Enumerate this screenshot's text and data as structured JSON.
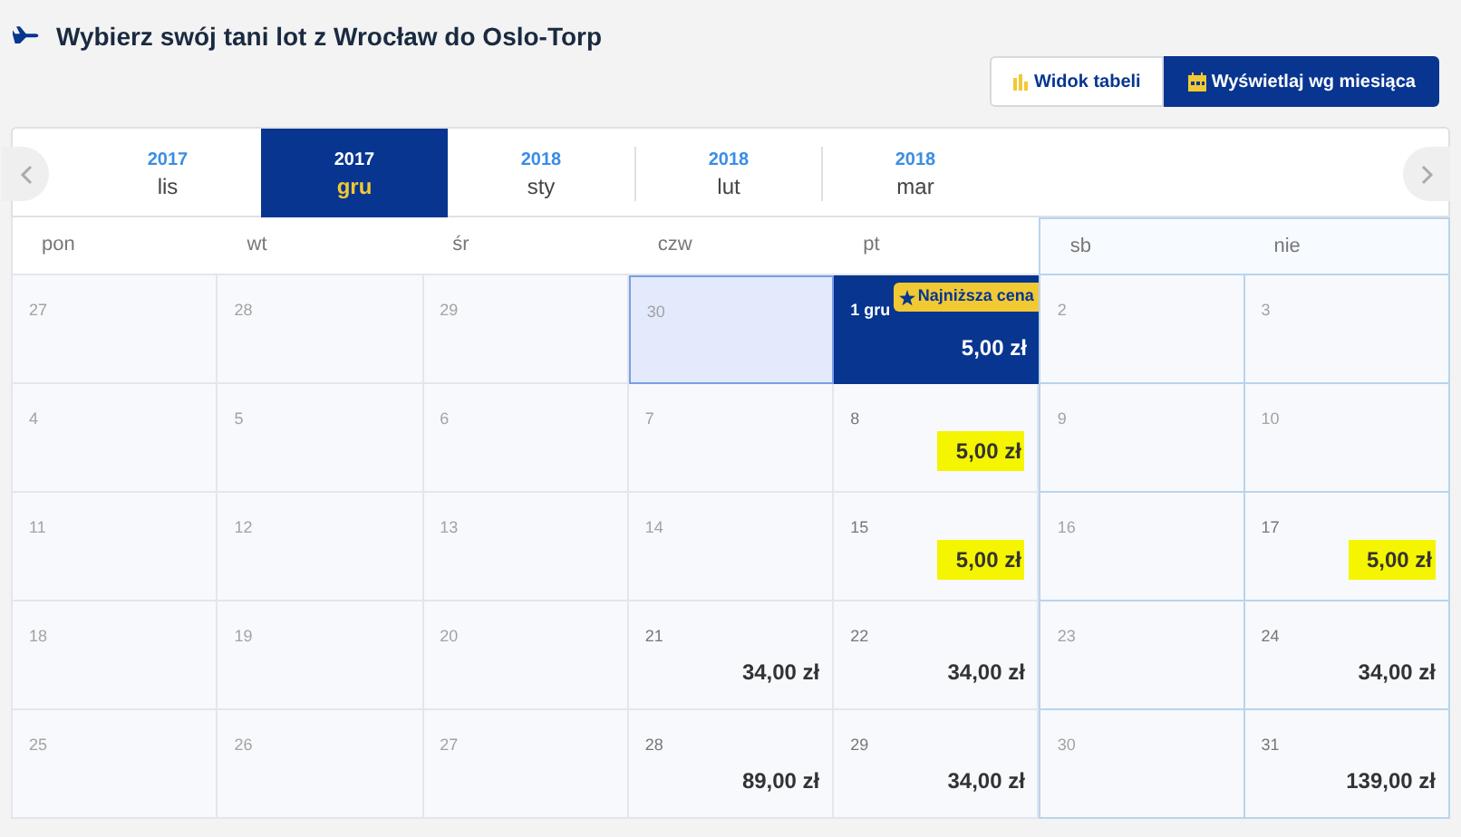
{
  "title": "Wybierz swój tani lot z Wrocław do Oslo-Torp",
  "view_buttons": [
    {
      "label": "Widok tabeli",
      "kind": "table",
      "selected": false
    },
    {
      "label": "Wyświetlaj wg miesiąca",
      "kind": "month",
      "selected": true
    }
  ],
  "months": [
    {
      "year": "2017",
      "month": "lis",
      "selected": false
    },
    {
      "year": "2017",
      "month": "gru",
      "selected": true
    },
    {
      "year": "2018",
      "month": "sty",
      "selected": false
    },
    {
      "year": "2018",
      "month": "lut",
      "selected": false
    },
    {
      "year": "2018",
      "month": "mar",
      "selected": false
    }
  ],
  "weekdays": [
    {
      "label": "pon",
      "weekend": false
    },
    {
      "label": "wt",
      "weekend": false
    },
    {
      "label": "śr",
      "weekend": false
    },
    {
      "label": "czw",
      "weekend": false
    },
    {
      "label": "pt",
      "weekend": false
    },
    {
      "label": "sb",
      "weekend": true
    },
    {
      "label": "nie",
      "weekend": true
    }
  ],
  "weeks": [
    [
      {
        "day": "27",
        "muted": true
      },
      {
        "day": "28",
        "muted": true
      },
      {
        "day": "29",
        "muted": true
      },
      {
        "day": "30",
        "muted": true,
        "hovered": true
      },
      {
        "day": "1 gru",
        "muted": false,
        "selected": true,
        "badge": "Najniższa cena",
        "price": "5,00 zł"
      },
      {
        "day": "2",
        "muted": true
      },
      {
        "day": "3",
        "muted": true
      }
    ],
    [
      {
        "day": "4",
        "muted": true
      },
      {
        "day": "5",
        "muted": true
      },
      {
        "day": "6",
        "muted": true
      },
      {
        "day": "7",
        "muted": true
      },
      {
        "day": "8",
        "muted": false,
        "price": "5,00 zł",
        "highlighted": true
      },
      {
        "day": "9",
        "muted": true
      },
      {
        "day": "10",
        "muted": true
      }
    ],
    [
      {
        "day": "11",
        "muted": true
      },
      {
        "day": "12",
        "muted": true
      },
      {
        "day": "13",
        "muted": true
      },
      {
        "day": "14",
        "muted": true
      },
      {
        "day": "15",
        "muted": false,
        "price": "5,00 zł",
        "highlighted": true
      },
      {
        "day": "16",
        "muted": true
      },
      {
        "day": "17",
        "muted": false,
        "price": "5,00 zł",
        "highlighted": true
      }
    ],
    [
      {
        "day": "18",
        "muted": true
      },
      {
        "day": "19",
        "muted": true
      },
      {
        "day": "20",
        "muted": true
      },
      {
        "day": "21",
        "muted": false,
        "price": "34,00 zł"
      },
      {
        "day": "22",
        "muted": false,
        "price": "34,00 zł"
      },
      {
        "day": "23",
        "muted": true
      },
      {
        "day": "24",
        "muted": false,
        "price": "34,00 zł"
      }
    ],
    [
      {
        "day": "25",
        "muted": true
      },
      {
        "day": "26",
        "muted": true
      },
      {
        "day": "27",
        "muted": true
      },
      {
        "day": "28",
        "muted": false,
        "price": "89,00 zł"
      },
      {
        "day": "29",
        "muted": false,
        "price": "34,00 zł"
      },
      {
        "day": "30",
        "muted": true
      },
      {
        "day": "31",
        "muted": false,
        "price": "139,00 zł"
      }
    ]
  ]
}
